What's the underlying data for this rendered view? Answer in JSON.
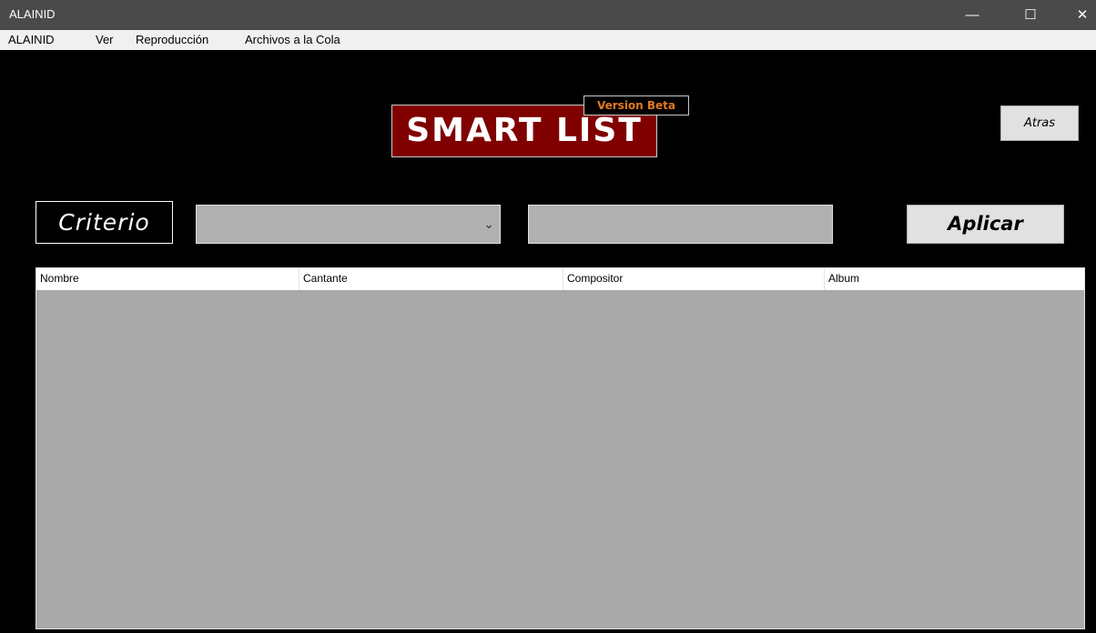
{
  "window": {
    "title": "ALAINID",
    "minimize_glyph": "—",
    "maximize_glyph": "☐",
    "close_glyph": "✕"
  },
  "menu": [
    "ALAINID",
    "Ver",
    "Reproducción",
    "Archivos a la Cola"
  ],
  "logo": {
    "text": "SMART LIST",
    "badge": "Version Beta"
  },
  "buttons": {
    "back": "Atras",
    "apply": "Aplicar"
  },
  "filter": {
    "label": "Criterio",
    "select_value": "",
    "search_value": "",
    "chevron_glyph": "⌄"
  },
  "table": {
    "columns": [
      "Nombre",
      "Cantante",
      "Compositor",
      "Album"
    ],
    "rows": []
  },
  "colors": {
    "background": "#000000",
    "title_bar": "#4a4a4a",
    "logo_bg": "#800000",
    "badge_text": "#e07a20",
    "field_bg": "#b1b1b1",
    "list_bg": "#a9a9a9"
  }
}
